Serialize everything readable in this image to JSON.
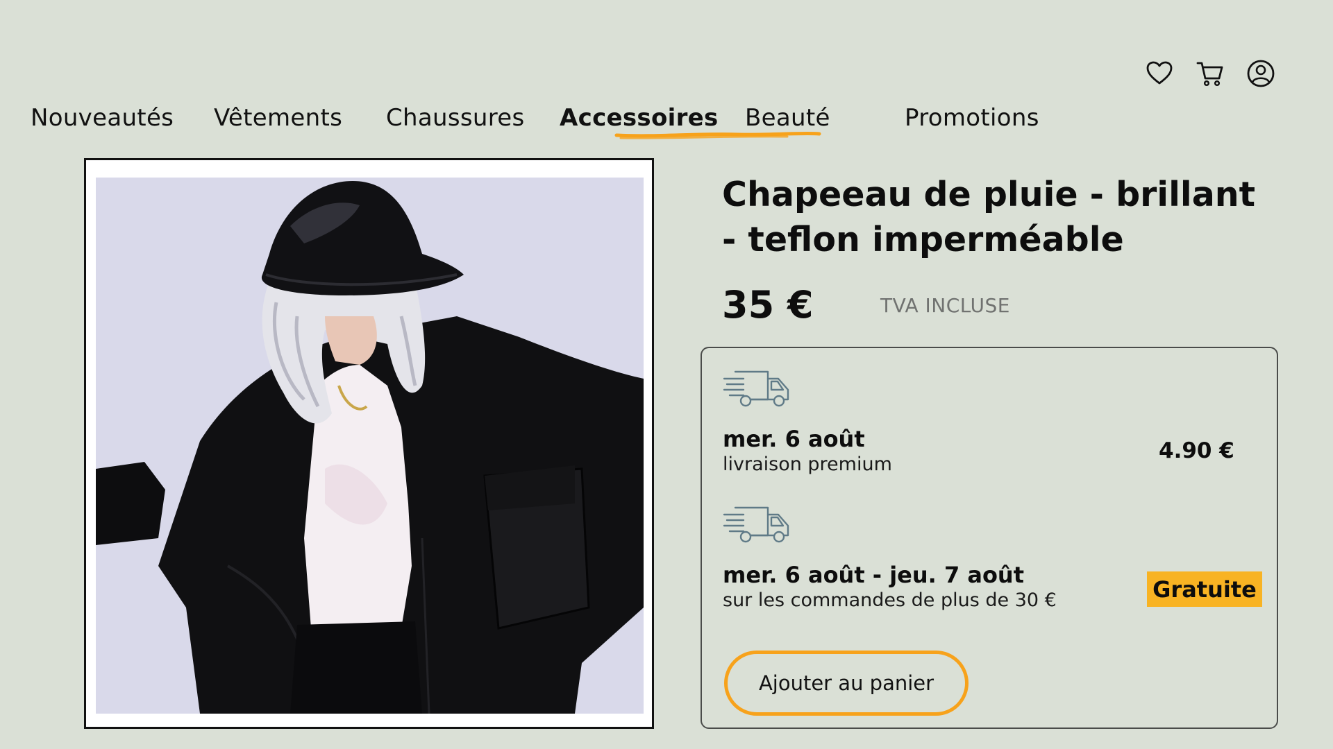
{
  "header": {
    "icons": [
      "heart-icon",
      "cart-icon",
      "account-icon"
    ]
  },
  "nav": {
    "items": [
      {
        "label": "Nouveautés"
      },
      {
        "label": "Vêtements"
      },
      {
        "label": "Chaussures"
      },
      {
        "label": "Accessoires",
        "active": true
      },
      {
        "label": "Beauté"
      },
      {
        "label": "Promotions"
      }
    ]
  },
  "product": {
    "title": "Chapeeau de pluie - brillant - teflon imperméable",
    "price": "35 €",
    "vat": "TVA INCLUSE"
  },
  "delivery": {
    "options": [
      {
        "date": "mer. 6 août",
        "description": "livraison premium",
        "price": "4.90 €",
        "icon": "delivery-truck-icon"
      },
      {
        "date": "mer. 6 août  - jeu. 7 août",
        "description": "sur les commandes de plus de 30 €",
        "price": "Gratuite",
        "icon": "delivery-truck-icon"
      }
    ],
    "add_to_cart_label": "Ajouter au panier"
  },
  "colors": {
    "background": "#dae0d6",
    "accent_orange": "#f7a21b",
    "badge_yellow": "#f8b323"
  }
}
